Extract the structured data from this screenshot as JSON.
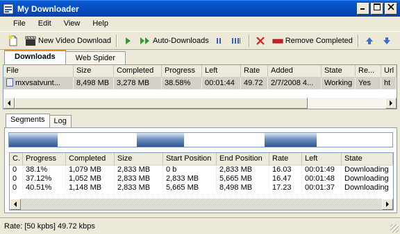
{
  "window": {
    "title": "My Downloader"
  },
  "menu": [
    "File",
    "Edit",
    "View",
    "Help"
  ],
  "toolbar": {
    "new_video_download": "New Video Download",
    "auto_downloads": "Auto-Downloads",
    "remove_completed": "Remove Completed"
  },
  "main_tabs": [
    "Downloads",
    "Web Spider"
  ],
  "downloads": {
    "headers": [
      "File",
      "Size",
      "Completed",
      "Progress",
      "Left",
      "Rate",
      "Added",
      "State",
      "Re...",
      "Url"
    ],
    "rows": [
      [
        "mxvsatvunt...",
        "8,498 MB",
        "3,278 MB",
        "38.58%",
        "00:01:44",
        "49.72",
        "2/7/2008 4...",
        "Working",
        "Yes",
        "ht"
      ]
    ]
  },
  "detail_tabs": [
    "Segments",
    "Log"
  ],
  "segments": {
    "headers": [
      "C.",
      "Progress",
      "Completed",
      "Size",
      "Start Position",
      "End Position",
      "Rate",
      "Left",
      "State"
    ],
    "rows": [
      [
        "0",
        "38.1%",
        "1,079 MB",
        "2,833 MB",
        "0 b",
        "2,833 MB",
        "16.03",
        "00:01:49",
        "Downloading"
      ],
      [
        "0",
        "37.12%",
        "1,052 MB",
        "2,833 MB",
        "2,833 MB",
        "5,665 MB",
        "16.47",
        "00:01:48",
        "Downloading"
      ],
      [
        "0",
        "40.51%",
        "1,148 MB",
        "2,833 MB",
        "5,665 MB",
        "8,498 MB",
        "17.23",
        "00:01:37",
        "Downloading"
      ]
    ],
    "progress_fractions": [
      0.381,
      0.3712,
      0.4051
    ]
  },
  "status": {
    "rate": "Rate:  [50 kpbs] 49.72 kbps"
  },
  "colors": {
    "title_bar": "#0a4fc2",
    "segment_fill": "#2f568f",
    "play_green": "#2e9a2e",
    "remove_red": "#d42020"
  }
}
